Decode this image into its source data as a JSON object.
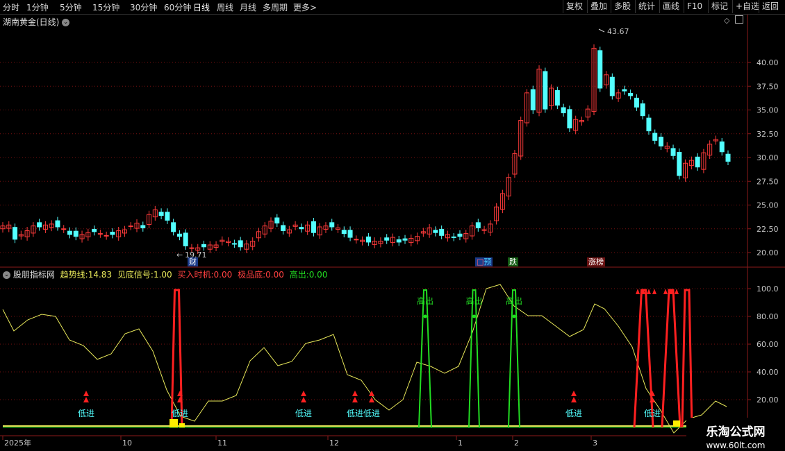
{
  "toolbar": {
    "periods": [
      "分时",
      "1分钟",
      "5分钟",
      "15分钟",
      "30分钟",
      "60分钟",
      "日线",
      "周线",
      "月线",
      "多周期",
      "更多"
    ],
    "active_period": "日线",
    "more_arrow": ">",
    "right_buttons": [
      "复权",
      "叠加",
      "多股",
      "统计",
      "画线",
      "F10",
      "标记",
      "+自选",
      "返回"
    ]
  },
  "main_panel": {
    "title": "湖南黄金(日线)",
    "high_label": "43.67",
    "low_label": "19.71",
    "event_tags": [
      "财",
      "预",
      "跌",
      "涨榜"
    ],
    "price_ticks": [
      "40.00",
      "37.50",
      "35.00",
      "32.50",
      "30.00",
      "27.50",
      "25.00",
      "22.50",
      "20.00"
    ]
  },
  "indicator_panel": {
    "title": "股朋指标网",
    "trend_label": "趋势线:",
    "trend_value": "14.83",
    "bottom_label": "见底信号:",
    "bottom_value": "1.00",
    "buy_label": "买入时机:",
    "buy_value": "0.00",
    "extreme_label": "极品底:",
    "extreme_value": "0.00",
    "high_out_label": "高出:",
    "high_out_value": "0.00",
    "ticks": [
      "100.0",
      "80.00",
      "60.00",
      "40.00",
      "20.00"
    ],
    "low_entry_text": "低进",
    "high_exit_text": "高出"
  },
  "time_axis": [
    "2025年",
    "10",
    "11",
    "12",
    "1",
    "2",
    "3"
  ],
  "watermark": {
    "name": "乐淘公式网",
    "url": "www.60lt.com"
  },
  "colors": {
    "up": "#ff3b3b",
    "down": "#53ffff",
    "trend": "#e8e85a",
    "signal": "#ff2020",
    "high": "#22dd22",
    "grid": "#7a1010"
  }
}
